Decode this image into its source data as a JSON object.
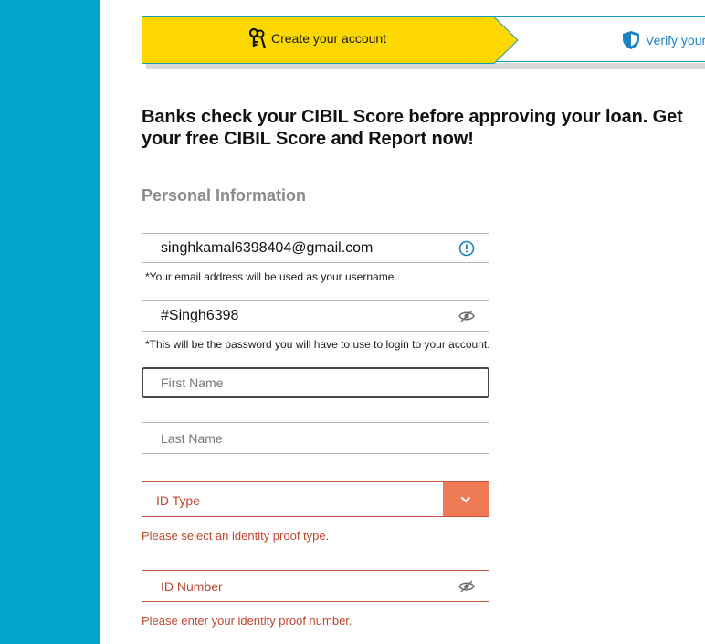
{
  "steps": {
    "active": {
      "label": "Create your account",
      "icon": "keys-icon"
    },
    "next": {
      "label": "Verify your",
      "icon": "shield-icon"
    }
  },
  "headline": "Banks check your CIBIL Score before approving your loan. Get your free CIBIL Score and Report now!",
  "section_title": "Personal Information",
  "form": {
    "email": {
      "value": "singhkamal6398404@gmail.com",
      "hint": "*Your email address will be used as your username.",
      "icon": "info-icon"
    },
    "password": {
      "value": "#Singh6398",
      "hint": "*This will be the password you will have to use to login to your account.",
      "icon": "eye-icon"
    },
    "first_name": {
      "placeholder": "First Name"
    },
    "last_name": {
      "placeholder": "Last Name"
    },
    "id_type": {
      "selected": "ID Type",
      "error": "Please select an identity proof type.",
      "icon": "chevron-down-icon"
    },
    "id_number": {
      "placeholder": "ID Number",
      "error": "Please enter your identity proof number.",
      "icon": "eye-icon"
    }
  },
  "colors": {
    "rail": "#00a5c9",
    "step_active": "#fcd800",
    "step_border": "#1a9bb5",
    "link": "#1b82c4",
    "error": "#c0472f",
    "select_button": "#ef7b56"
  }
}
